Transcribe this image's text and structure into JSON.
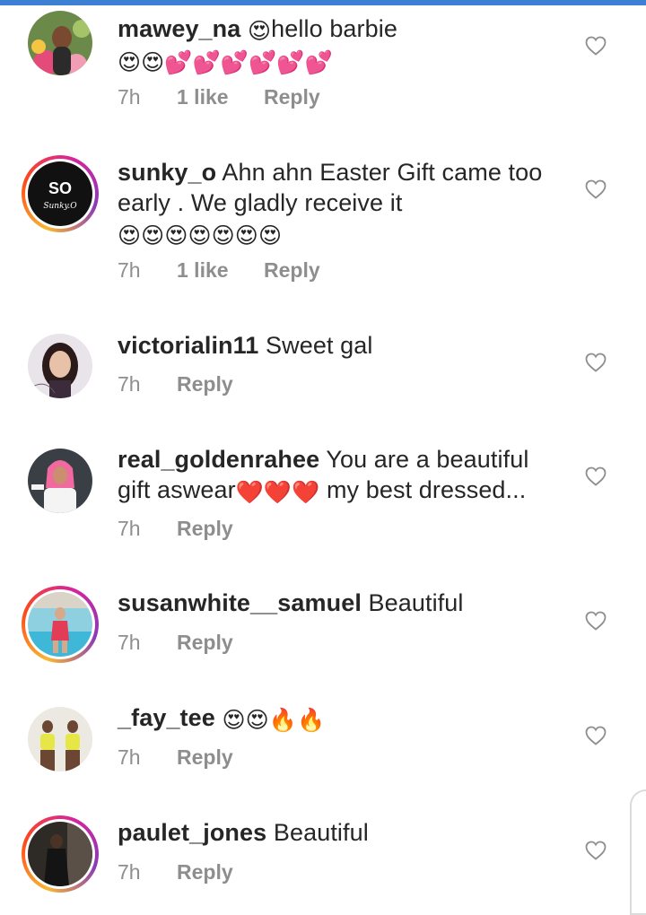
{
  "comments": [
    {
      "username": "mawey_na",
      "segments": [
        "😍",
        "hello barbie",
        "😍😍💕💕💕💕💕💕"
      ],
      "time": "7h",
      "likes": "1 like",
      "reply": "Reply",
      "avatar": "photo-woman-flowers",
      "story_ring": false
    },
    {
      "username": "sunky_o",
      "text": "Ahn ahn Easter Gift came too early . We gladly receive it",
      "emojis": "😍😍😍😍😍😍😍",
      "time": "7h",
      "likes": "1 like",
      "reply": "Reply",
      "avatar": "logo-sunky-o",
      "avatar_logo_text": "Sunky.O",
      "story_ring": true
    },
    {
      "username": "victorialin11",
      "text": "Sweet gal",
      "time": "7h",
      "reply": "Reply",
      "avatar": "photo-woman-portrait",
      "story_ring": false
    },
    {
      "username": "real_goldenrahee",
      "text": "You are a beautiful gift aswear",
      "emojis": "❤️❤️❤️",
      "text_tail": "my best dressed...",
      "time": "7h",
      "reply": "Reply",
      "avatar": "photo-woman-pink-hijab",
      "story_ring": false
    },
    {
      "username": "susanwhite__samuel",
      "text": "Beautiful",
      "time": "7h",
      "reply": "Reply",
      "avatar": "photo-woman-pool",
      "story_ring": true
    },
    {
      "username": "_fay_tee",
      "emojis": "😍😍🔥🔥",
      "time": "7h",
      "reply": "Reply",
      "avatar": "photo-women-group",
      "story_ring": false
    },
    {
      "username": "paulet_jones",
      "text": "Beautiful",
      "time": "7h",
      "reply": "Reply",
      "avatar": "photo-woman-dark",
      "story_ring": true
    }
  ],
  "colors": {
    "top_bar": "#3d7fd3",
    "text": "#262626",
    "meta": "#8e8e8e",
    "heart_outline": "#8e8e8e"
  },
  "icons": {
    "like": "heart-outline-icon"
  }
}
